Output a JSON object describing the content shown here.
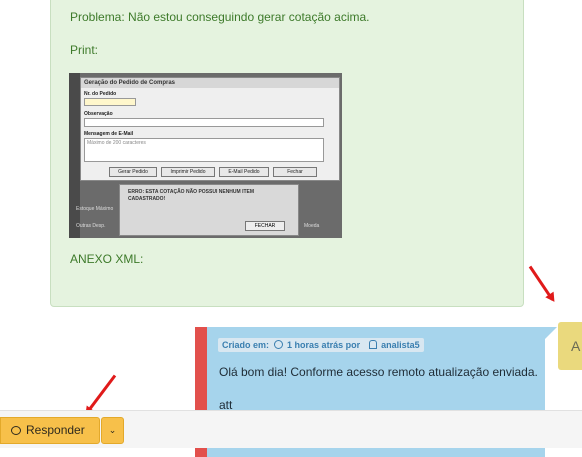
{
  "ticket": {
    "problem_text": "Problema: Não estou conseguindo gerar cotação acima.",
    "print_label": "Print:",
    "annex_label": "ANEXO XML:"
  },
  "embedded_screenshot": {
    "dialog_title": "Geração do Pedido de Compras",
    "field_order_number": "Nr. do Pedido",
    "field_observation": "Observação",
    "field_email_message": "Mensagem de E-Mail",
    "email_placeholder": "Máximo de 200 caracteres",
    "buttons": [
      "Gerar Pedido",
      "Imprimir Pedido",
      "E-Mail Pedido",
      "Fechar"
    ],
    "error_text": "ERRO: ESTA COTAÇÃO NÃO POSSUI NENHUM ITEM CADASTRADO!",
    "error_button": "FECHAR",
    "side_labels": [
      "Estoque Máximo",
      "Outras Desp.",
      "Moeda"
    ]
  },
  "reply": {
    "created_label": "Criado em:",
    "time": "1 horas atrás",
    "by_label": "por",
    "author": "analista5",
    "line1": "Olá bom dia! Conforme acesso remoto atualização enviada.",
    "line2": "att"
  },
  "side_card": {
    "letter": "A"
  },
  "footer": {
    "reply_button": "Responder",
    "dropdown_icon": "chevron-down-icon"
  },
  "colors": {
    "green_card": "#e5f3df",
    "green_text": "#3d7a2a",
    "reply_bubble": "#a6d4ec",
    "reply_accent": "#e2504c",
    "reply_button": "#f7c04a",
    "arrow": "#e01a1a"
  }
}
